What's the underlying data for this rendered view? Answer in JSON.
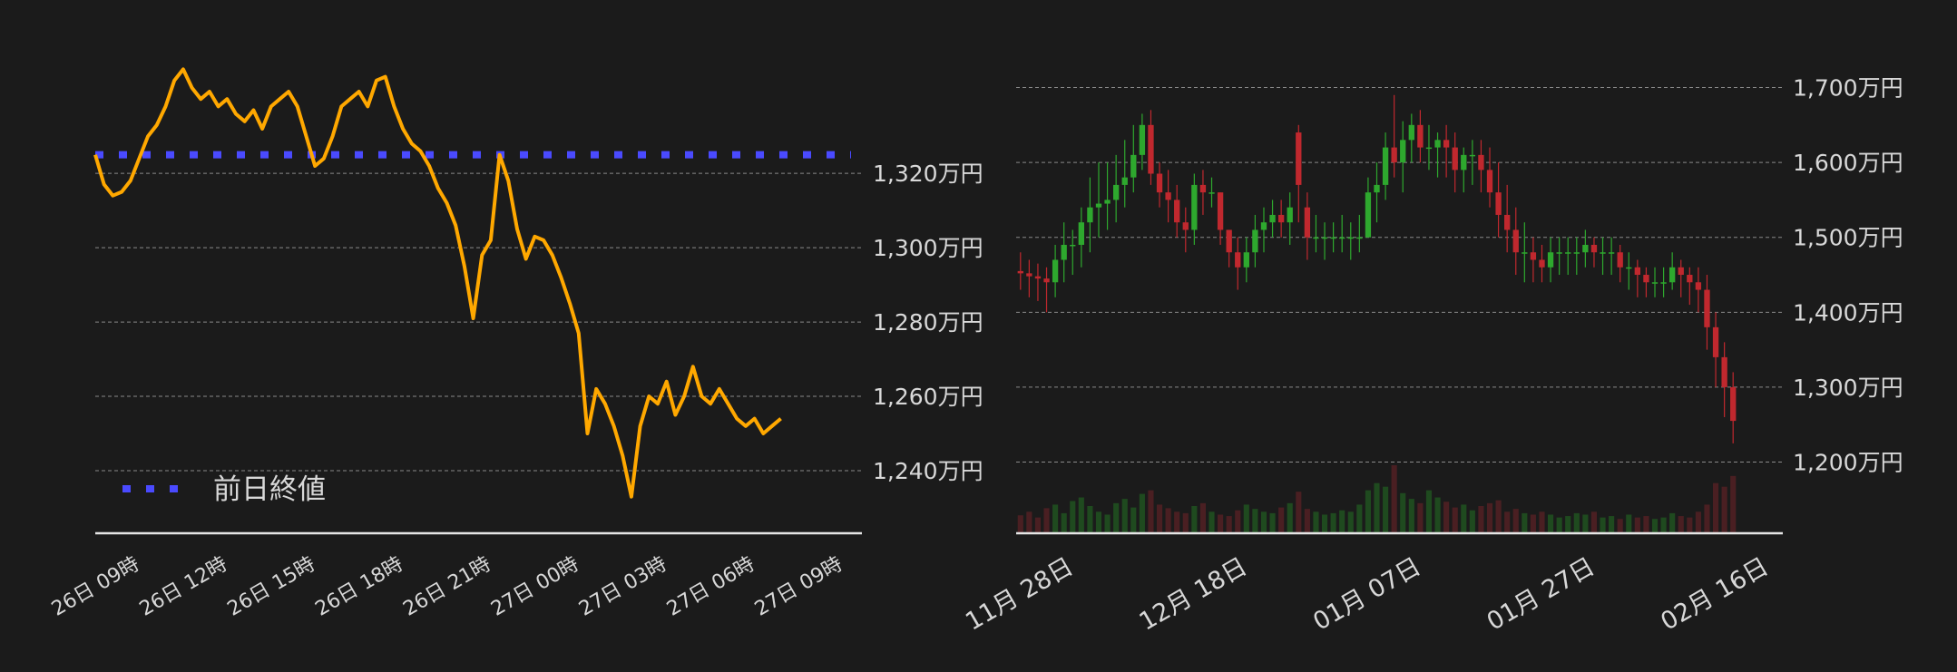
{
  "colors": {
    "background": "#1b1b1b",
    "price_line": "#ffa800",
    "prev_close": "#4a4aff",
    "candle_up": "#2ea82e",
    "candle_down": "#c0282e",
    "grid": "#8a8a8a",
    "text": "#d8d8d8"
  },
  "chart_data": [
    {
      "type": "line",
      "ylim": [
        1230,
        1352
      ],
      "y_ticks": [
        1240,
        1260,
        1280,
        1300,
        1320
      ],
      "y_tick_labels": [
        "1,240万円",
        "1,260万円",
        "1,280万円",
        "1,300万円",
        "1,320万円"
      ],
      "x_tick_labels": [
        "26日 09時",
        "26日 12時",
        "26日 15時",
        "26日 18時",
        "26日 21時",
        "27日 00時",
        "27日 03時",
        "27日 06時",
        "27日 09時"
      ],
      "x_hours": [
        0,
        3,
        6,
        9,
        12,
        15,
        18,
        21,
        24
      ],
      "previous_close": 1325,
      "legend": [
        {
          "name": "前日終値",
          "style": "dotted"
        }
      ],
      "grid": true,
      "series": [
        {
          "x": [
            0,
            0.3,
            0.6,
            0.9,
            1.2,
            1.5,
            1.8,
            2.1,
            2.4,
            2.7,
            3.0,
            3.3,
            3.6,
            3.9,
            4.2,
            4.5,
            4.8,
            5.1,
            5.4,
            5.7,
            6.0,
            6.3,
            6.6,
            6.9,
            7.2,
            7.5,
            7.8,
            8.1,
            8.4,
            8.7,
            9.0,
            9.3,
            9.6,
            9.9,
            10.2,
            10.5,
            10.8,
            11.1,
            11.4,
            11.7,
            12.0,
            12.3,
            12.6,
            12.9,
            13.2,
            13.5,
            13.8,
            14.1,
            14.4,
            14.7,
            15.0,
            15.3,
            15.6,
            15.9,
            16.2,
            16.5,
            16.8,
            17.1,
            17.4,
            17.7,
            18.0,
            18.3,
            18.6,
            18.9,
            19.2,
            19.5,
            19.8,
            20.1,
            20.4,
            20.7,
            21.0,
            21.3,
            21.6,
            21.9,
            22.2,
            22.5,
            22.8,
            23.1,
            23.4
          ],
          "y": [
            1325,
            1317,
            1314,
            1315,
            1318,
            1324,
            1330,
            1333,
            1338,
            1345,
            1348,
            1343,
            1340,
            1342,
            1338,
            1340,
            1336,
            1334,
            1337,
            1332,
            1338,
            1340,
            1342,
            1338,
            1330,
            1322,
            1324,
            1330,
            1338,
            1340,
            1342,
            1338,
            1345,
            1346,
            1338,
            1332,
            1328,
            1326,
            1322,
            1316,
            1312,
            1306,
            1295,
            1281,
            1298,
            1302,
            1325,
            1318,
            1305,
            1297,
            1303,
            1302,
            1298,
            1292,
            1285,
            1277,
            1250,
            1262,
            1258,
            1252,
            1244,
            1233,
            1252,
            1260,
            1258,
            1264,
            1255,
            1260,
            1268,
            1260,
            1258,
            1262,
            1258,
            1254,
            1252,
            1254,
            1250,
            1252,
            1254
          ]
        }
      ]
    },
    {
      "type": "bar",
      "subtype": "candlestick",
      "ylim": [
        1105,
        1720
      ],
      "y_ticks": [
        1200,
        1300,
        1400,
        1500,
        1600,
        1700
      ],
      "y_tick_labels": [
        "1,200万円",
        "1,300万円",
        "1,400万円",
        "1,500万円",
        "1,600万円",
        "1,700万円"
      ],
      "x_tick_labels": [
        "11月 28日",
        "12月 18日",
        "01月 07日",
        "01月 27日",
        "02月 16日"
      ],
      "x_tick_index": [
        0,
        20,
        40,
        60,
        80
      ],
      "grid": true,
      "open": [
        1455,
        1452,
        1448,
        1445,
        1440,
        1470,
        1490,
        1490,
        1520,
        1540,
        1545,
        1550,
        1570,
        1580,
        1610,
        1650,
        1585,
        1560,
        1550,
        1520,
        1510,
        1570,
        1560,
        1560,
        1510,
        1480,
        1460,
        1480,
        1510,
        1520,
        1530,
        1520,
        1640,
        1540,
        1500,
        1500,
        1500,
        1500,
        1500,
        1500,
        1500,
        1560,
        1570,
        1620,
        1600,
        1630,
        1650,
        1620,
        1620,
        1630,
        1620,
        1590,
        1610,
        1610,
        1590,
        1560,
        1530,
        1510,
        1480,
        1480,
        1470,
        1460,
        1480,
        1480,
        1480,
        1480,
        1490,
        1480,
        1480,
        1480,
        1460,
        1460,
        1450,
        1440,
        1440,
        1440,
        1460,
        1450,
        1440,
        1430,
        1380,
        1340,
        1300
      ],
      "close": [
        1452,
        1448,
        1445,
        1440,
        1470,
        1490,
        1490,
        1520,
        1540,
        1545,
        1550,
        1570,
        1580,
        1610,
        1650,
        1585,
        1560,
        1550,
        1520,
        1510,
        1570,
        1560,
        1560,
        1510,
        1480,
        1460,
        1480,
        1510,
        1520,
        1530,
        1520,
        1540,
        1570,
        1500,
        1500,
        1500,
        1500,
        1500,
        1500,
        1500,
        1560,
        1570,
        1620,
        1600,
        1630,
        1650,
        1620,
        1620,
        1630,
        1620,
        1590,
        1610,
        1610,
        1590,
        1560,
        1530,
        1510,
        1480,
        1480,
        1470,
        1460,
        1480,
        1480,
        1480,
        1480,
        1490,
        1480,
        1480,
        1480,
        1460,
        1460,
        1450,
        1440,
        1440,
        1440,
        1460,
        1450,
        1440,
        1430,
        1380,
        1340,
        1300,
        1255
      ],
      "high": [
        1480,
        1470,
        1465,
        1460,
        1490,
        1520,
        1510,
        1540,
        1580,
        1600,
        1600,
        1610,
        1630,
        1650,
        1665,
        1670,
        1600,
        1590,
        1570,
        1540,
        1585,
        1590,
        1580,
        1560,
        1510,
        1500,
        1500,
        1530,
        1540,
        1550,
        1550,
        1560,
        1650,
        1560,
        1530,
        1520,
        1520,
        1530,
        1520,
        1530,
        1580,
        1600,
        1640,
        1690,
        1655,
        1665,
        1670,
        1650,
        1640,
        1650,
        1640,
        1620,
        1630,
        1630,
        1620,
        1600,
        1570,
        1540,
        1520,
        1500,
        1490,
        1500,
        1500,
        1500,
        1500,
        1510,
        1500,
        1500,
        1500,
        1490,
        1480,
        1470,
        1460,
        1460,
        1460,
        1480,
        1470,
        1460,
        1460,
        1450,
        1400,
        1360,
        1320
      ],
      "low": [
        1430,
        1420,
        1415,
        1400,
        1420,
        1440,
        1450,
        1460,
        1480,
        1500,
        1510,
        1520,
        1540,
        1560,
        1590,
        1570,
        1540,
        1520,
        1500,
        1480,
        1490,
        1530,
        1540,
        1490,
        1460,
        1430,
        1440,
        1460,
        1480,
        1500,
        1500,
        1490,
        1520,
        1470,
        1480,
        1470,
        1480,
        1480,
        1470,
        1480,
        1500,
        1520,
        1550,
        1580,
        1560,
        1600,
        1600,
        1590,
        1580,
        1580,
        1560,
        1560,
        1570,
        1560,
        1540,
        1500,
        1480,
        1450,
        1440,
        1440,
        1440,
        1440,
        1450,
        1450,
        1450,
        1460,
        1460,
        1450,
        1450,
        1440,
        1430,
        1420,
        1420,
        1420,
        1420,
        1430,
        1420,
        1410,
        1400,
        1350,
        1300,
        1260,
        1225
      ],
      "volume": [
        25,
        30,
        22,
        35,
        40,
        28,
        45,
        50,
        38,
        30,
        26,
        42,
        48,
        36,
        55,
        60,
        40,
        35,
        30,
        28,
        38,
        42,
        30,
        26,
        24,
        32,
        40,
        34,
        30,
        28,
        36,
        42,
        58,
        34,
        30,
        26,
        28,
        32,
        30,
        40,
        60,
        70,
        65,
        95,
        56,
        48,
        42,
        60,
        50,
        44,
        36,
        40,
        32,
        38,
        42,
        46,
        30,
        34,
        28,
        26,
        30,
        26,
        22,
        24,
        28,
        26,
        30,
        22,
        24,
        20,
        26,
        22,
        24,
        20,
        22,
        28,
        24,
        22,
        30,
        40,
        70,
        65,
        80
      ]
    }
  ]
}
